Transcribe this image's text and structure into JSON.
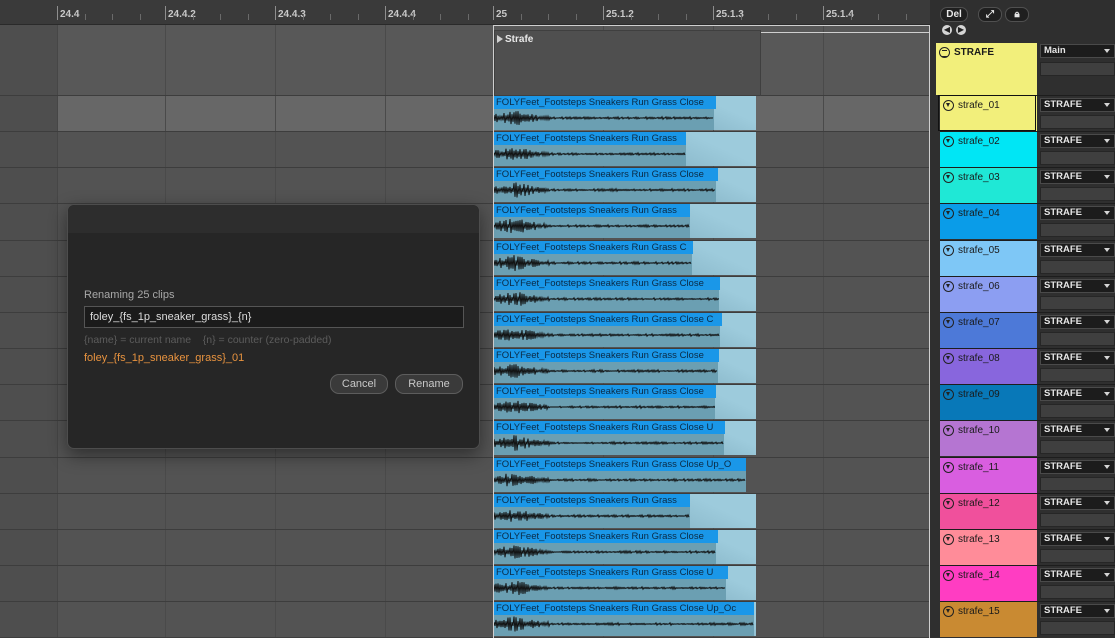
{
  "ruler": {
    "labels": [
      "24.4",
      "24.4.2",
      "24.4.3",
      "24.4.4",
      "25",
      "25.1.2",
      "25.1.3",
      "25.1.4"
    ]
  },
  "group_clip": {
    "name": "Strafe"
  },
  "clip_names": [
    "FOLYFeet_Footsteps Sneakers Run Grass Close",
    "FOLYFeet_Footsteps Sneakers Run Grass",
    "FOLYFeet_Footsteps Sneakers Run Grass Close",
    "FOLYFeet_Footsteps Sneakers Run Grass",
    "FOLYFeet_Footsteps Sneakers Run Grass C",
    "FOLYFeet_Footsteps Sneakers Run Grass Close",
    "FOLYFeet_Footsteps Sneakers Run Grass Close C",
    "FOLYFeet_Footsteps Sneakers Run Grass Close",
    "FOLYFeet_Footsteps Sneakers Run Grass Close",
    "FOLYFeet_Footsteps Sneakers Run Grass Close U",
    "FOLYFeet_Footsteps Sneakers Run Grass Close Up_O",
    "FOLYFeet_Footsteps Sneakers Run Grass",
    "FOLYFeet_Footsteps Sneakers Run Grass Close",
    "FOLYFeet_Footsteps Sneakers Run Grass Close U",
    "FOLYFeet_Footsteps Sneakers Run Grass Close Up_Oc"
  ],
  "dialog": {
    "title": "Renaming 25 clips",
    "input_value": "foley_{fs_1p_sneaker_grass}_{n}",
    "hint": "{name} = current name    {n} = counter (zero-padded)",
    "preview": "foley_{fs_1p_sneaker_grass}_01",
    "cancel_label": "Cancel",
    "rename_label": "Rename"
  },
  "top_buttons": {
    "del_label": "Del"
  },
  "group_track": {
    "name": "STRAFE",
    "output": "Main",
    "color": "#f2ef7b"
  },
  "tracks": [
    {
      "name": "strafe_01",
      "color": "#f2ef7b",
      "output": "STRAFE"
    },
    {
      "name": "strafe_02",
      "color": "#00e6f5",
      "output": "STRAFE"
    },
    {
      "name": "strafe_03",
      "color": "#1fe8d6",
      "output": "STRAFE"
    },
    {
      "name": "strafe_04",
      "color": "#0a9ce8",
      "output": "STRAFE"
    },
    {
      "name": "strafe_05",
      "color": "#7ec7f6",
      "output": "STRAFE"
    },
    {
      "name": "strafe_06",
      "color": "#8c9ef2",
      "output": "STRAFE"
    },
    {
      "name": "strafe_07",
      "color": "#4d79d8",
      "output": "STRAFE"
    },
    {
      "name": "strafe_08",
      "color": "#8866dd",
      "output": "STRAFE"
    },
    {
      "name": "strafe_09",
      "color": "#0878b8",
      "output": "STRAFE"
    },
    {
      "name": "strafe_10",
      "color": "#b575d2",
      "output": "STRAFE"
    },
    {
      "name": "strafe_11",
      "color": "#d95ee0",
      "output": "STRAFE"
    },
    {
      "name": "strafe_12",
      "color": "#f0509c",
      "output": "STRAFE"
    },
    {
      "name": "strafe_13",
      "color": "#ff8c99",
      "output": "STRAFE"
    },
    {
      "name": "strafe_14",
      "color": "#ff3dc2",
      "output": "STRAFE"
    },
    {
      "name": "strafe_15",
      "color": "#c98a32",
      "output": "STRAFE"
    }
  ]
}
